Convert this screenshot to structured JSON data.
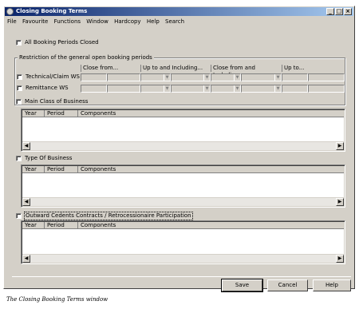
{
  "window": {
    "title": "Closing Booking Terms",
    "controls": {
      "minimize": "_",
      "maximize": "□",
      "close": "×"
    }
  },
  "menu": [
    "File",
    "Favourite",
    "Functions",
    "Window",
    "Hardcopy",
    "Help",
    "Search"
  ],
  "all_closed": {
    "label": "All Booking Periods Closed",
    "checked": false
  },
  "restriction": {
    "title": "Restriction of the general open booking periods",
    "headers": [
      "Close from...",
      "Up to and Including...",
      "Close from and Including ...",
      "Up to..."
    ],
    "rows": [
      {
        "label": "Technical/Claim WS",
        "checked": false
      },
      {
        "label": "Remittance WS",
        "checked": false
      }
    ]
  },
  "sections": [
    {
      "label": "Main Class of Business",
      "checked": false,
      "columns": [
        "Year",
        "Period",
        "Components"
      ]
    },
    {
      "label": "Type Of Business",
      "checked": false,
      "columns": [
        "Year",
        "Period",
        "Components"
      ]
    },
    {
      "label": "Outward Cedents Contracts / Retrocessionaire Participation",
      "checked": false,
      "columns": [
        "Year",
        "Period",
        "Components"
      ]
    }
  ],
  "buttons": {
    "save": "Save",
    "cancel": "Cancel",
    "help": "Help"
  },
  "caption": "The Closing Booking Terms window",
  "icons": [
    "app-icon",
    "scroll-left-arrow",
    "scroll-right-arrow",
    "dropdown-arrow"
  ]
}
